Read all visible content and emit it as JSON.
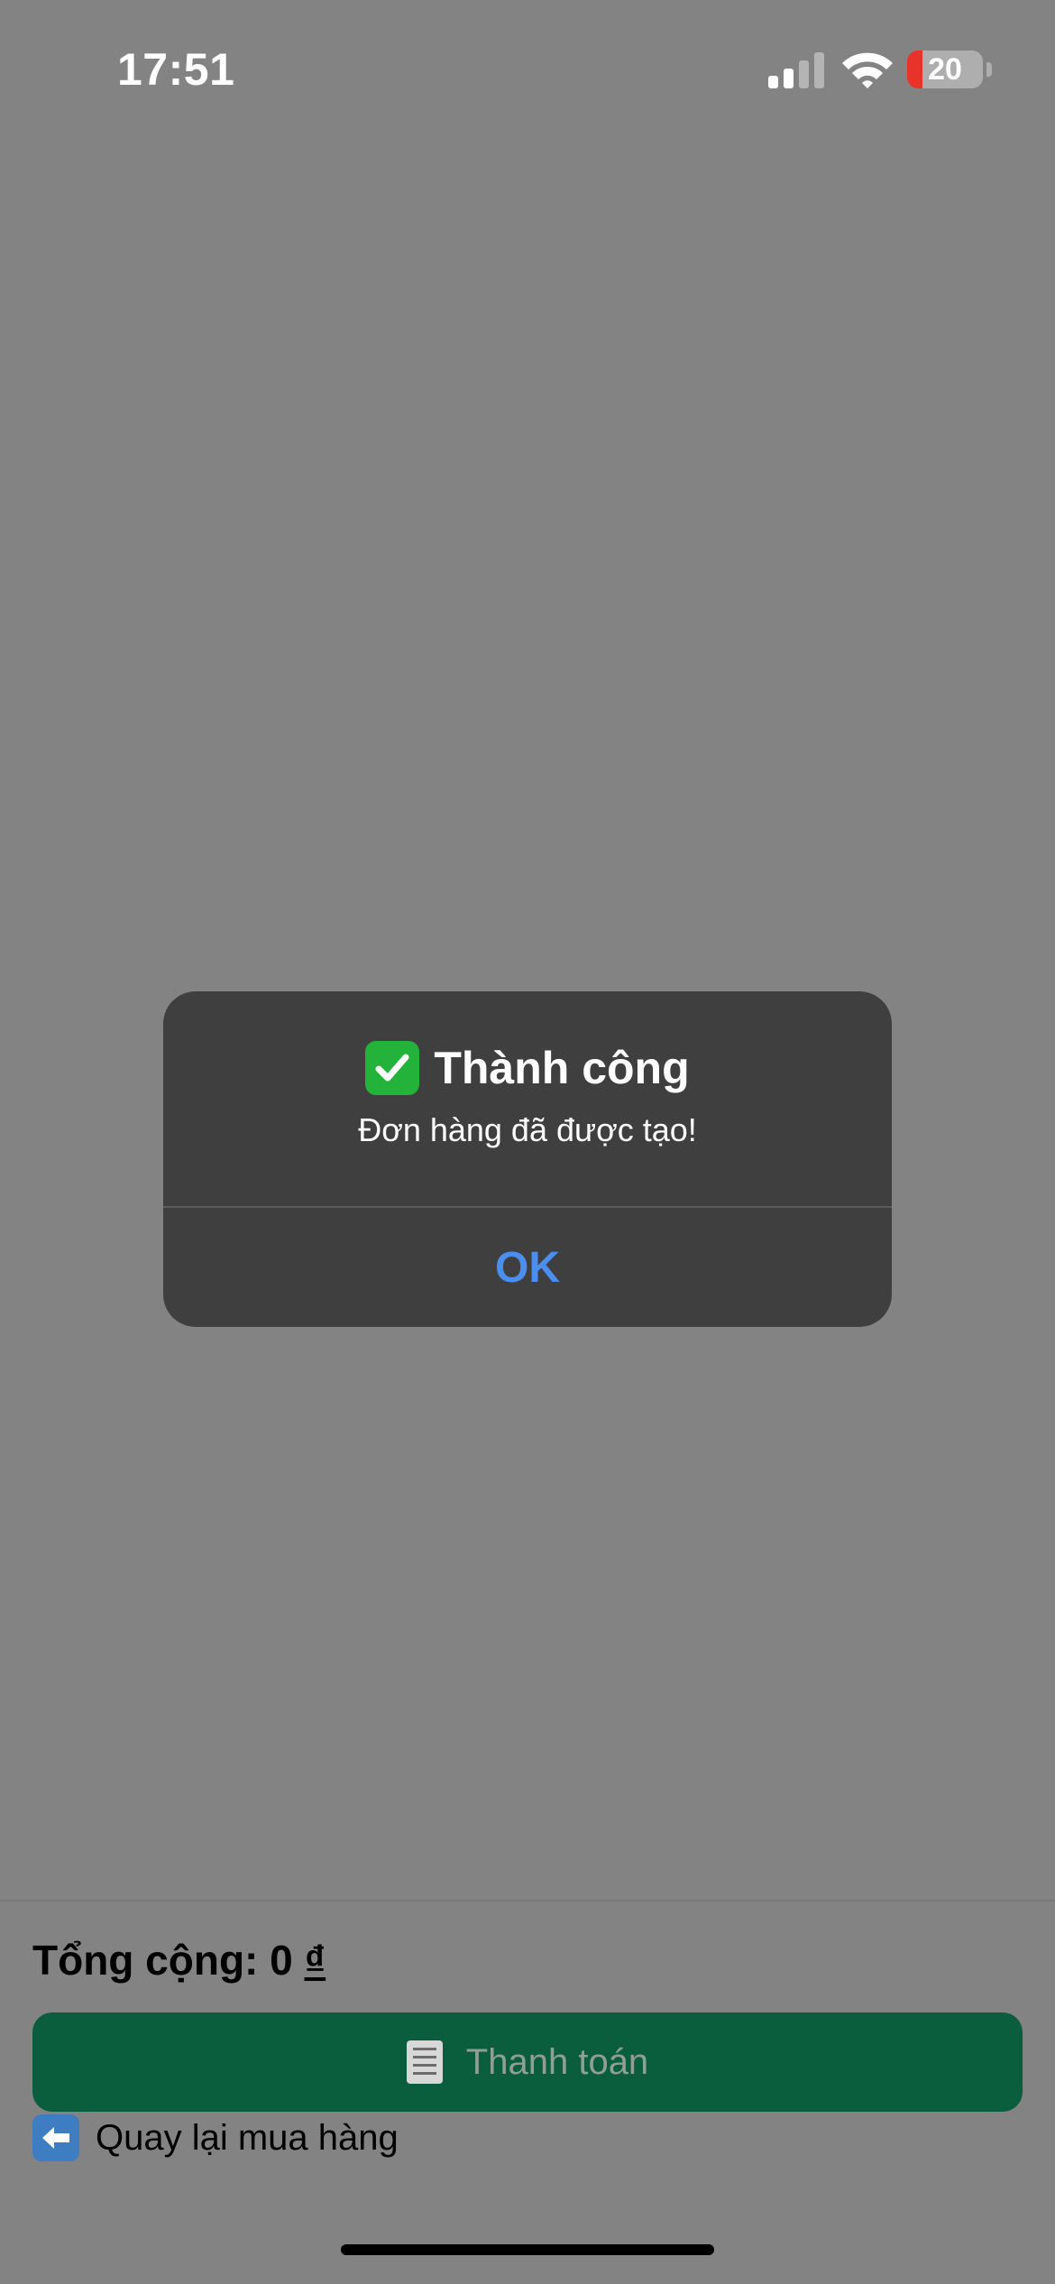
{
  "status_bar": {
    "time": "17:51",
    "battery_level": "20",
    "battery_color": "#e8332b",
    "signal_bars_active": 2
  },
  "alert": {
    "icon": "check-mark-icon",
    "title": "Thành công",
    "message": "Đơn hàng đã được tạo!",
    "button_label": "OK"
  },
  "cart": {
    "total_label": "Tổng cộng: 0",
    "currency": "₫",
    "checkout_icon": "receipt-icon",
    "checkout_label": "Thanh toán",
    "back_icon": "left-arrow-icon",
    "back_label": "Quay lại mua hàng"
  },
  "colors": {
    "overlay": "#838383",
    "alert_background": "#3f3f3f",
    "alert_button": "#4a8ff0",
    "checkout_button": "#0a5e3e"
  }
}
